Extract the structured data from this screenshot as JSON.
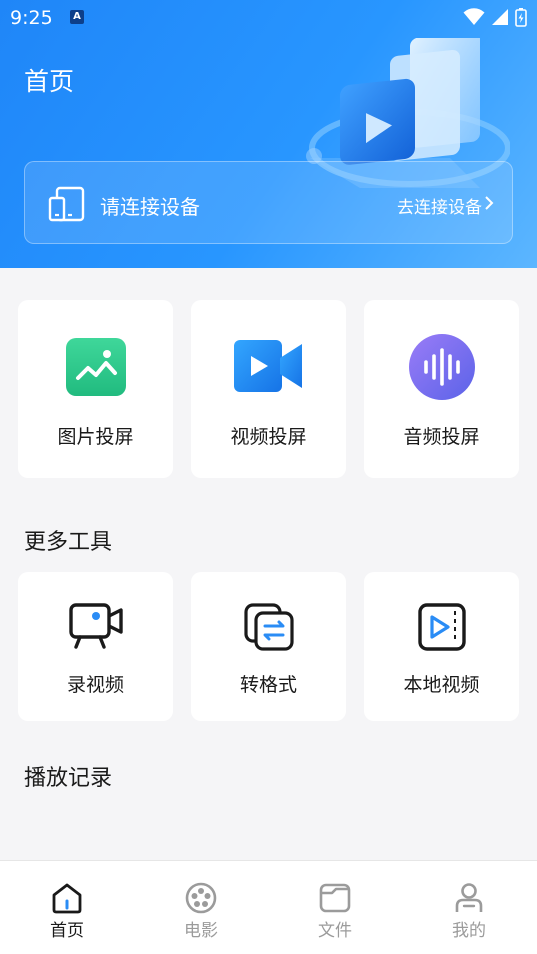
{
  "status_bar": {
    "time": "9:25",
    "notification_badge": "A"
  },
  "header": {
    "title": "首页"
  },
  "connect_card": {
    "label": "请连接设备",
    "action": "去连接设备"
  },
  "cast_cards": [
    {
      "label": "图片投屏",
      "icon": "image-icon",
      "color": "#2cc98a"
    },
    {
      "label": "视频投屏",
      "icon": "video-camera-icon",
      "color": "#1d8ff5"
    },
    {
      "label": "音频投屏",
      "icon": "audio-wave-icon",
      "color": "#7b6cf0"
    }
  ],
  "more_tools": {
    "title": "更多工具",
    "items": [
      {
        "label": "录视频",
        "icon": "record-video-icon"
      },
      {
        "label": "转格式",
        "icon": "convert-format-icon"
      },
      {
        "label": "本地视频",
        "icon": "local-video-icon"
      }
    ]
  },
  "history": {
    "title": "播放记录"
  },
  "bottom_nav": {
    "items": [
      {
        "label": "首页",
        "icon": "home-icon",
        "active": true
      },
      {
        "label": "电影",
        "icon": "film-reel-icon",
        "active": false
      },
      {
        "label": "文件",
        "icon": "folder-icon",
        "active": false
      },
      {
        "label": "我的",
        "icon": "profile-icon",
        "active": false
      }
    ]
  },
  "colors": {
    "accent": "#1f86f8",
    "tool_accent": "#2a8cf5",
    "background": "#f5f5f7"
  }
}
